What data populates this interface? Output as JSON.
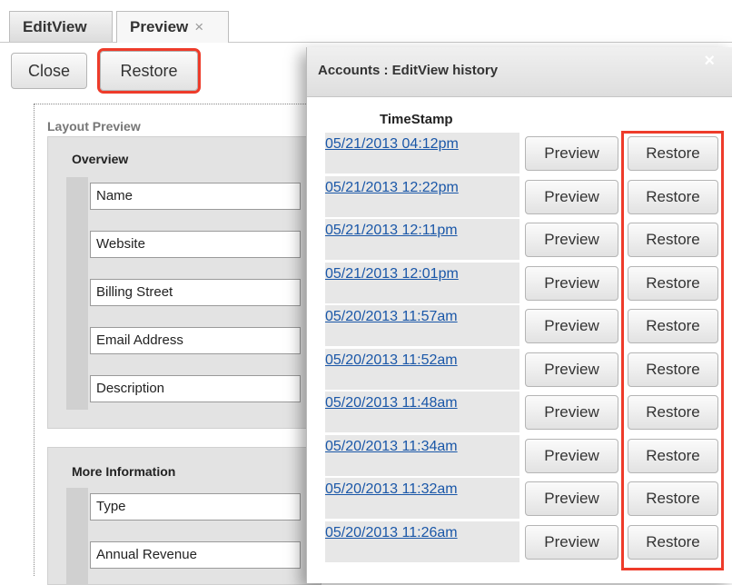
{
  "tabs": [
    {
      "label": "EditView"
    },
    {
      "label": "Preview",
      "close": "×"
    }
  ],
  "toolbar": {
    "close_label": "Close",
    "restore_label": "Restore"
  },
  "layout": {
    "title": "Layout Preview",
    "panels": [
      {
        "title": "Overview",
        "fields": [
          "Name",
          "Website",
          "Billing Street",
          "Email Address",
          "Description"
        ]
      },
      {
        "title": "More Information",
        "fields": [
          "Type",
          "Annual Revenue"
        ]
      }
    ]
  },
  "dialog": {
    "title": "Accounts : EditView history",
    "close": "×",
    "column_header": "TimeStamp",
    "preview_label": "Preview",
    "restore_label": "Restore",
    "rows": [
      {
        "timestamp": "05/21/2013 04:12pm"
      },
      {
        "timestamp": "05/21/2013 12:22pm"
      },
      {
        "timestamp": "05/21/2013 12:11pm"
      },
      {
        "timestamp": "05/21/2013 12:01pm"
      },
      {
        "timestamp": "05/20/2013 11:57am"
      },
      {
        "timestamp": "05/20/2013 11:52am"
      },
      {
        "timestamp": "05/20/2013 11:48am"
      },
      {
        "timestamp": "05/20/2013 11:34am"
      },
      {
        "timestamp": "05/20/2013 11:32am"
      },
      {
        "timestamp": "05/20/2013 11:26am"
      }
    ]
  },
  "colors": {
    "highlight": "#ee3b2a",
    "link": "#1a57a8"
  }
}
